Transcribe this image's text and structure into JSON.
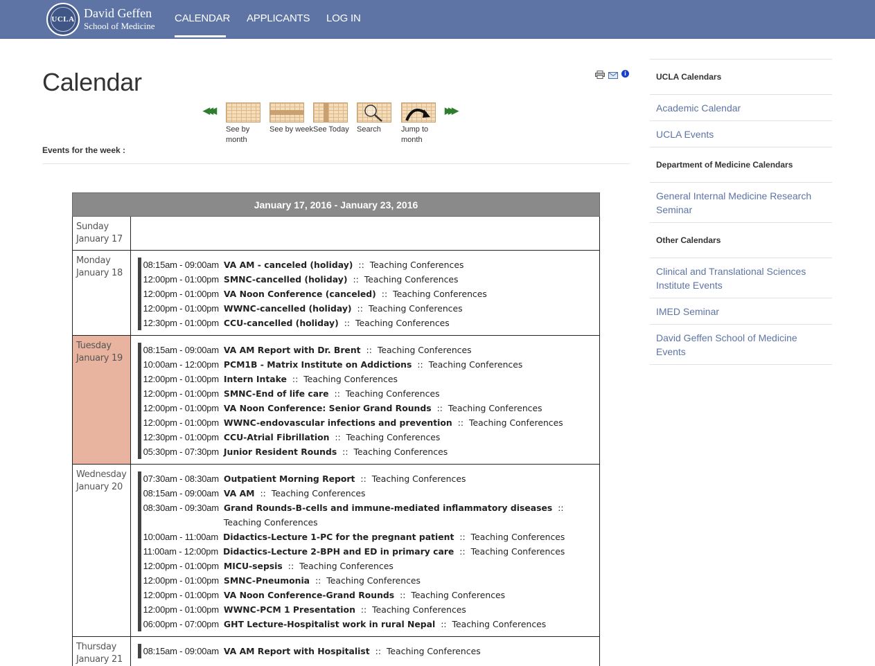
{
  "header": {
    "seal_text": "UCLA",
    "logo_line1": "David Geffen",
    "logo_line2": "School of Medicine",
    "nav": [
      {
        "label": "CALENDAR"
      },
      {
        "label": "APPLICANTS"
      },
      {
        "label": "LOG IN"
      }
    ],
    "active_nav": "CALENDAR",
    "color": "#5d74a5"
  },
  "page": {
    "title": "Calendar",
    "week_label": "Events for the week :"
  },
  "tools": {
    "print_icon": "printer-icon",
    "email_icon": "envelope-icon",
    "info_icon": "info-icon",
    "info_glyph": "i"
  },
  "calendar_nav": {
    "prev_arrows": "◀◀◀",
    "next_arrows": "▶▶▶",
    "items": [
      {
        "label": "See by month",
        "label_l1": "See by",
        "label_l2": "month"
      },
      {
        "label": "See by week"
      },
      {
        "label": "See Today"
      },
      {
        "label": "Search"
      },
      {
        "label": "Jump to month",
        "label_l1": "Jump to",
        "label_l2": "month"
      }
    ]
  },
  "week": {
    "range": "January 17, 2016 - January 23, 2016",
    "days": [
      {
        "weekday": "Sunday",
        "date": "January 17",
        "today": false,
        "events": []
      },
      {
        "weekday": "Monday",
        "date": "January 18",
        "today": false,
        "events": [
          {
            "time": "08:15am - 09:00am",
            "title": "VA AM - canceled (holiday)",
            "category": "Teaching Conferences"
          },
          {
            "time": "12:00pm - 01:00pm",
            "title": "SMNC-cancelled (holiday)",
            "category": "Teaching Conferences"
          },
          {
            "time": "12:00pm - 01:00pm",
            "title": "VA Noon Conference (canceled)",
            "category": "Teaching Conferences"
          },
          {
            "time": "12:00pm - 01:00pm",
            "title": "WWNC-cancelled (holiday)",
            "category": "Teaching Conferences"
          },
          {
            "time": "12:30pm - 01:00pm",
            "title": "CCU-cancelled (holiday)",
            "category": "Teaching Conferences"
          }
        ]
      },
      {
        "weekday": "Tuesday",
        "date": "January 19",
        "today": true,
        "events": [
          {
            "time": "08:15am - 09:00am",
            "title": "VA AM Report with Dr. Brent",
            "category": "Teaching Conferences"
          },
          {
            "time": "10:00am - 12:00pm",
            "title": "PCM1B - Matrix Institute on Addictions",
            "category": "Teaching Conferences"
          },
          {
            "time": "12:00pm - 01:00pm",
            "title": "Intern Intake",
            "category": "Teaching Conferences"
          },
          {
            "time": "12:00pm - 01:00pm",
            "title": "SMNC-End of life care",
            "category": "Teaching Conferences"
          },
          {
            "time": "12:00pm - 01:00pm",
            "title": "VA Noon Conference: Senior Grand Rounds",
            "category": "Teaching Conferences"
          },
          {
            "time": "12:00pm - 01:00pm",
            "title": "WWNC-endovascular infections and prevention",
            "category": "Teaching Conferences"
          },
          {
            "time": "12:30pm - 01:00pm",
            "title": "CCU-Atrial Fibrillation",
            "category": "Teaching Conferences"
          },
          {
            "time": "05:30pm - 07:30pm",
            "title": "Junior Resident Rounds",
            "category": "Teaching Conferences"
          }
        ]
      },
      {
        "weekday": "Wednesday",
        "date": "January 20",
        "today": false,
        "events": [
          {
            "time": "07:30am - 08:30am",
            "title": "Outpatient Morning Report",
            "category": "Teaching Conferences"
          },
          {
            "time": "08:15am - 09:00am",
            "title": "VA AM",
            "category": "Teaching Conferences"
          },
          {
            "time": "08:30am - 09:30am",
            "title": "Grand Rounds-B-cells and immune-mediated inflammatory diseases",
            "category": "Teaching Conferences"
          },
          {
            "time": "10:00am - 11:00am",
            "title": "Didactics-Lecture 1-PC for the pregnant patient",
            "category": "Teaching Conferences"
          },
          {
            "time": "11:00am - 12:00pm",
            "title": "Didactics-Lecture 2-BPH and ED in primary care",
            "category": "Teaching Conferences"
          },
          {
            "time": "12:00pm - 01:00pm",
            "title": "MICU-sepsis",
            "category": "Teaching Conferences"
          },
          {
            "time": "12:00pm - 01:00pm",
            "title": "SMNC-Pneumonia",
            "category": "Teaching Conferences"
          },
          {
            "time": "12:00pm - 01:00pm",
            "title": "VA Noon Conference-Grand Rounds",
            "category": "Teaching Conferences"
          },
          {
            "time": "12:00pm - 01:00pm",
            "title": "WWNC-PCM 1 Presentation",
            "category": "Teaching Conferences"
          },
          {
            "time": "06:00pm - 07:00pm",
            "title": "GHT Lecture-Hospitalist work in rural Nepal",
            "category": "Teaching Conferences"
          }
        ]
      },
      {
        "weekday": "Thursday",
        "date": "January 21",
        "today": false,
        "events": [
          {
            "time": "08:15am - 09:00am",
            "title": "VA AM Report with Hospitalist",
            "category": "Teaching Conferences"
          }
        ]
      }
    ],
    "separator": "::",
    "today_color": "#e8b4a0",
    "header_color": "#8a8a8a"
  },
  "sidebar": {
    "sections": [
      {
        "heading": "UCLA Calendars",
        "links": [
          "Academic Calendar",
          "UCLA Events"
        ]
      },
      {
        "heading": "Department of Medicine Calendars",
        "links": [
          "General Internal Medicine Research Seminar"
        ]
      },
      {
        "heading": "Other Calendars",
        "links": [
          "Clinical and Translational Sciences Institute Events",
          "IMED Seminar",
          "David Geffen School of Medicine Events"
        ]
      }
    ],
    "link_color": "#5d74a5"
  }
}
